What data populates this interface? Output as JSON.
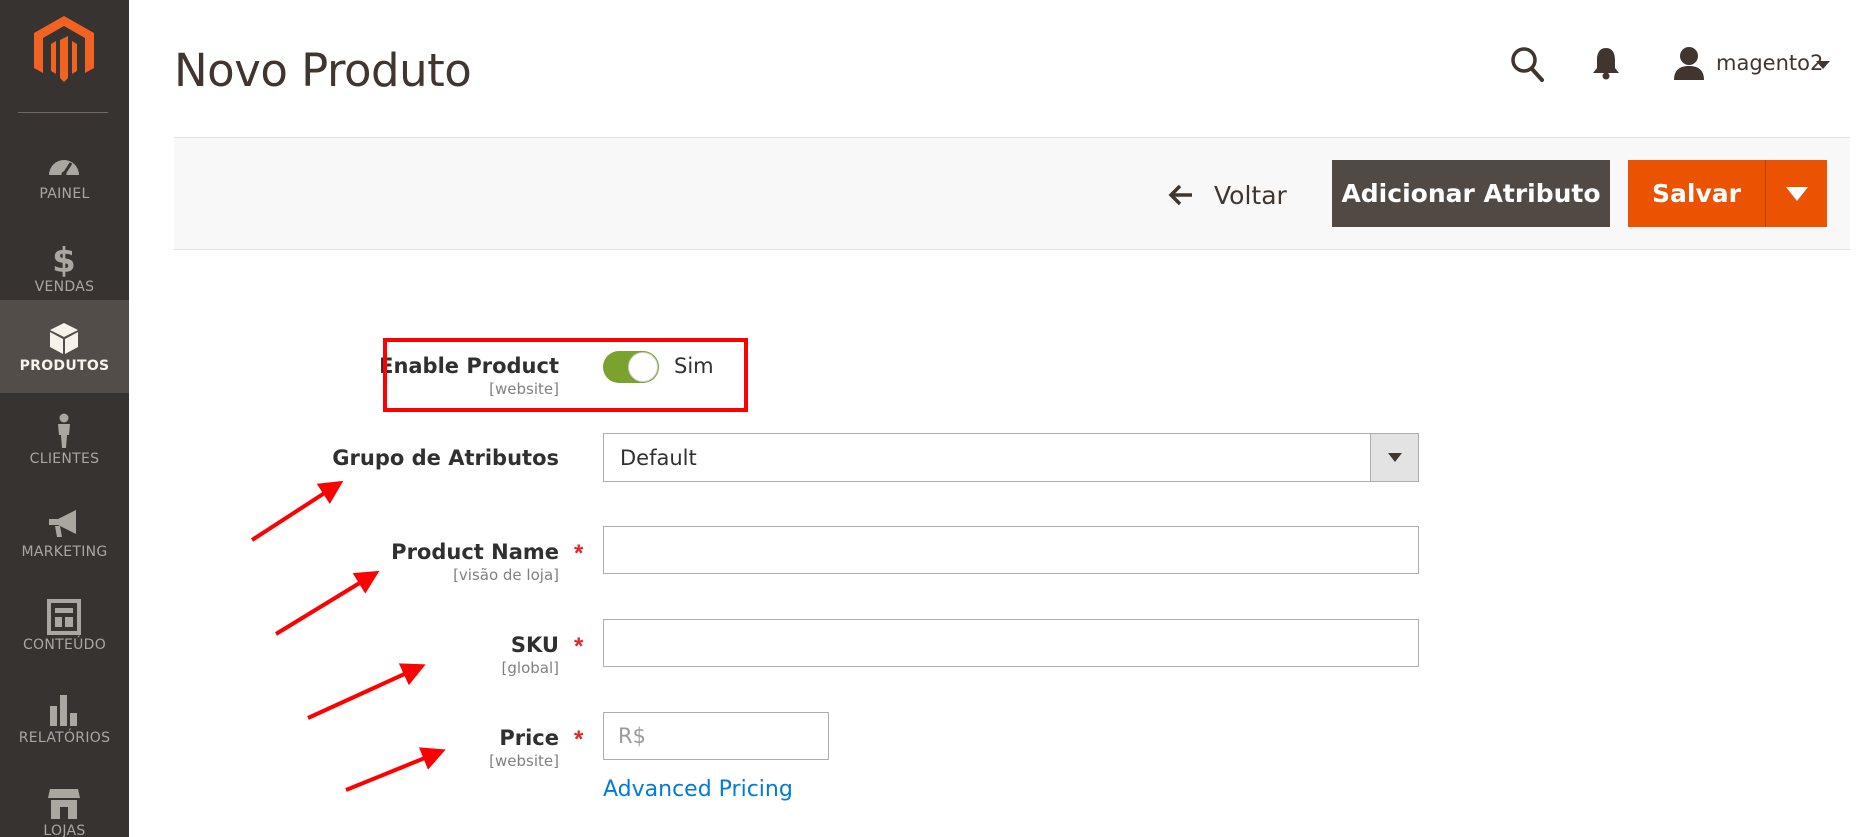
{
  "sidebar": {
    "items": [
      {
        "label": "PAINEL",
        "icon": "dashboard-icon"
      },
      {
        "label": "VENDAS",
        "icon": "dollar-icon"
      },
      {
        "label": "PRODUTOS",
        "icon": "box-icon",
        "active": true
      },
      {
        "label": "CLIENTES",
        "icon": "person-icon"
      },
      {
        "label": "MARKETING",
        "icon": "megaphone-icon"
      },
      {
        "label": "CONTEÚDO",
        "icon": "layout-icon"
      },
      {
        "label": "RELATÓRIOS",
        "icon": "bar-chart-icon"
      },
      {
        "label": "LOJAS",
        "icon": "store-icon"
      }
    ]
  },
  "header": {
    "title": "Novo Produto",
    "user": "magento2"
  },
  "toolbar": {
    "back_label": "Voltar",
    "add_attribute_label": "Adicionar Atributo",
    "save_label": "Salvar"
  },
  "form": {
    "enable_product": {
      "label": "Enable Product",
      "scope": "[website]",
      "value_text": "Sim",
      "enabled": true
    },
    "attribute_set": {
      "label": "Grupo de Atributos",
      "value": "Default"
    },
    "product_name": {
      "label": "Product Name",
      "scope": "[visão de loja]",
      "value": "",
      "required": true
    },
    "sku": {
      "label": "SKU",
      "scope": "[global]",
      "value": "",
      "required": true
    },
    "price": {
      "label": "Price",
      "scope": "[website]",
      "placeholder": "R$",
      "value": "",
      "required": true
    },
    "advanced_pricing_label": "Advanced Pricing",
    "required_mark": "*"
  },
  "colors": {
    "sidebar_bg": "#373330",
    "accent_orange": "#eb5202",
    "toggle_on": "#79a22e",
    "annotation_red": "#ff0000",
    "link_blue": "#007bdb"
  }
}
